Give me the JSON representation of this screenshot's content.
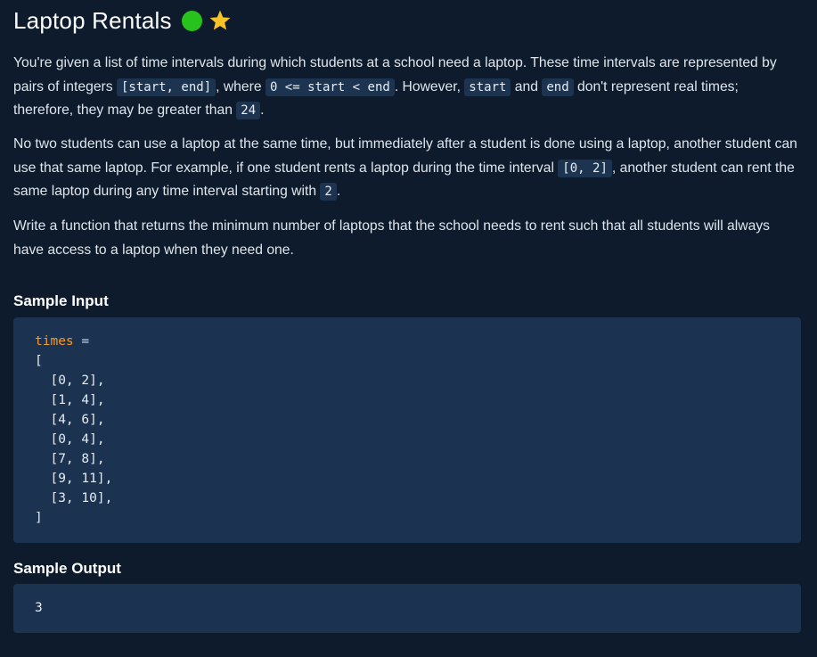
{
  "problem": {
    "title": "Laptop Rentals",
    "difficulty_color": "#27c21b",
    "favorite_icon": "star-icon",
    "favorite_color": "#f7c325"
  },
  "description": {
    "p1": {
      "t1": "You're given a list of time intervals during which students at a school need a laptop. These time intervals are represented by pairs of integers ",
      "c1": "[start, end]",
      "t2": ", where ",
      "c2": "0 <= start < end",
      "t3": ". However, ",
      "c3": "start",
      "t4": " and ",
      "c4": "end",
      "t5": " don't represent real times; therefore, they may be greater than ",
      "c5": "24",
      "t6": "."
    },
    "p2": {
      "t1": "No two students can use a laptop at the same time, but immediately after a student is done using a laptop, another student can use that same laptop. For example, if one student rents a laptop during the time interval ",
      "c1": "[0, 2]",
      "t2": ", another student can rent the same laptop during any time interval starting with ",
      "c2": "2",
      "t3": "."
    },
    "p3": "Write a function that returns the minimum number of laptops that the school needs to rent such that all students will always have access to a laptop when they need one."
  },
  "sample_input": {
    "heading": "Sample Input",
    "var_name": "times",
    "assign": " =",
    "open": "[",
    "rows": [
      "  [0, 2],",
      "  [1, 4],",
      "  [4, 6],",
      "  [0, 4],",
      "  [7, 8],",
      "  [9, 11],",
      "  [3, 10],"
    ],
    "close": "]"
  },
  "sample_output": {
    "heading": "Sample Output",
    "value": "3"
  }
}
